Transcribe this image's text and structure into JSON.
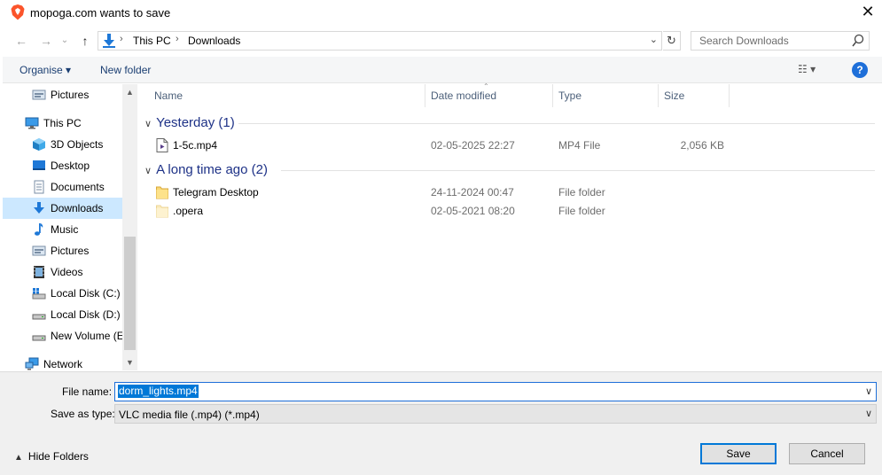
{
  "window": {
    "title": "mopoga.com wants to save",
    "close_glyph": "✕"
  },
  "address": {
    "crumbs": [
      "This PC",
      "Downloads"
    ],
    "separator": "›",
    "search_placeholder": "Search Downloads",
    "back_glyph": "←",
    "forward_glyph": "→",
    "up_glyph": "↑",
    "recent_glyph": "⌄",
    "dropdown_glyph": "⌄",
    "refresh_glyph": "↻"
  },
  "toolbar": {
    "organise_label": "Organise ▾",
    "new_folder_label": "New folder",
    "view_glyph": "☷  ▾",
    "help_glyph": "?"
  },
  "nav": {
    "items": [
      {
        "label": "Pictures",
        "icon": "pictures-icon"
      },
      {
        "label": "This PC",
        "icon": "this-pc-icon"
      },
      {
        "label": "3D Objects",
        "icon": "3d-objects-icon"
      },
      {
        "label": "Desktop",
        "icon": "desktop-icon"
      },
      {
        "label": "Documents",
        "icon": "documents-icon"
      },
      {
        "label": "Downloads",
        "icon": "downloads-icon",
        "selected": true
      },
      {
        "label": "Music",
        "icon": "music-icon"
      },
      {
        "label": "Pictures",
        "icon": "pictures-icon"
      },
      {
        "label": "Videos",
        "icon": "videos-icon"
      },
      {
        "label": "Local Disk (C:)",
        "icon": "local-disk-c-icon"
      },
      {
        "label": "Local Disk (D:)",
        "icon": "drive-icon"
      },
      {
        "label": "New Volume (E",
        "icon": "drive-icon"
      },
      {
        "label": "Network",
        "icon": "network-icon"
      }
    ]
  },
  "columns": {
    "name": "Name",
    "date_modified": "Date modified",
    "type": "Type",
    "size": "Size"
  },
  "groups": [
    {
      "label": "Yesterday (1)",
      "files": [
        {
          "name": "1-5c.mp4",
          "date": "02-05-2025 22:27",
          "type": "MP4 File",
          "size": "2,056 KB",
          "icon": "video-file-icon"
        }
      ]
    },
    {
      "label": "A long time ago (2)",
      "files": [
        {
          "name": "Telegram Desktop",
          "date": "24-11-2024 00:47",
          "type": "File folder",
          "size": "",
          "icon": "folder-icon"
        },
        {
          "name": ".opera",
          "date": "02-05-2021 08:20",
          "type": "File folder",
          "size": "",
          "icon": "folder-icon"
        }
      ]
    }
  ],
  "bottom": {
    "file_name_label": "File name:",
    "file_name_value": "dorm_lights.mp4",
    "save_as_type_label": "Save as type:",
    "save_as_type_value": "VLC media file (.mp4) (*.mp4)",
    "hide_folders_label": "Hide Folders",
    "save_label": "Save",
    "cancel_label": "Cancel"
  },
  "colors": {
    "accent": "#0078d7",
    "selection": "#cce8ff",
    "group_heading": "#1e3287",
    "link_text": "#1a3e72"
  }
}
